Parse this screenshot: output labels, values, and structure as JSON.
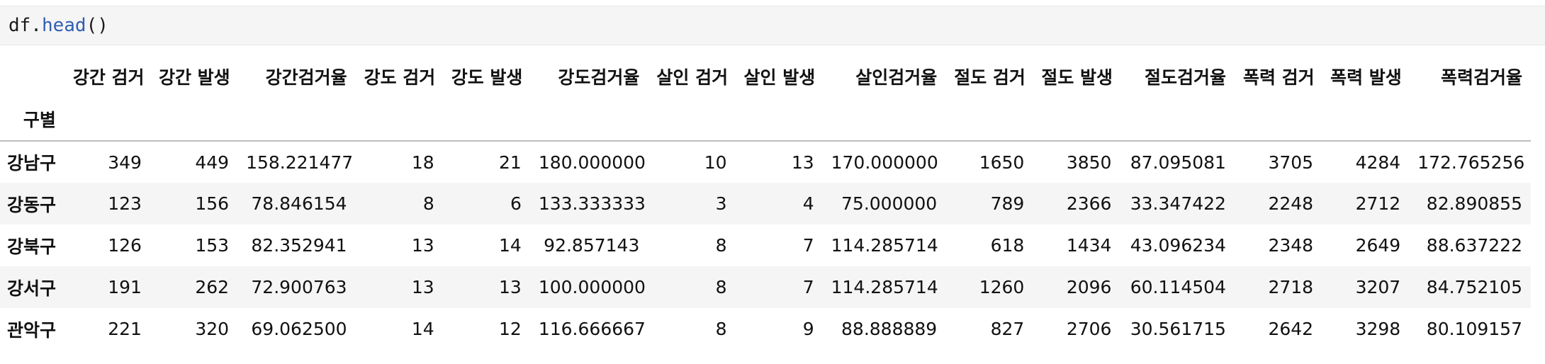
{
  "code_cell": {
    "prefix": "df.",
    "function": "head",
    "suffix": "()"
  },
  "table": {
    "index_name": "구별",
    "columns": [
      "강간 검거",
      "강간 발생",
      "강간검거율",
      "강도 검거",
      "강도 발생",
      "강도검거율",
      "살인 검거",
      "살인 발생",
      "살인검거율",
      "절도 검거",
      "절도 발생",
      "절도검거율",
      "폭력 검거",
      "폭력 발생",
      "폭력검거율"
    ],
    "rows": [
      {
        "index": "강남구",
        "values": [
          "349",
          "449",
          "158.221477",
          "18",
          "21",
          "180.000000",
          "10",
          "13",
          "170.000000",
          "1650",
          "3850",
          "87.095081",
          "3705",
          "4284",
          "172.765256"
        ]
      },
      {
        "index": "강동구",
        "values": [
          "123",
          "156",
          "78.846154",
          "8",
          "6",
          "133.333333",
          "3",
          "4",
          "75.000000",
          "789",
          "2366",
          "33.347422",
          "2248",
          "2712",
          "82.890855"
        ]
      },
      {
        "index": "강북구",
        "values": [
          "126",
          "153",
          "82.352941",
          "13",
          "14",
          "92.857143",
          "8",
          "7",
          "114.285714",
          "618",
          "1434",
          "43.096234",
          "2348",
          "2649",
          "88.637222"
        ]
      },
      {
        "index": "강서구",
        "values": [
          "191",
          "262",
          "72.900763",
          "13",
          "13",
          "100.000000",
          "8",
          "7",
          "114.285714",
          "1260",
          "2096",
          "60.114504",
          "2718",
          "3207",
          "84.752105"
        ]
      },
      {
        "index": "관악구",
        "values": [
          "221",
          "320",
          "69.062500",
          "14",
          "12",
          "116.666667",
          "8",
          "9",
          "88.888889",
          "827",
          "2706",
          "30.561715",
          "2642",
          "3298",
          "80.109157"
        ]
      }
    ]
  }
}
